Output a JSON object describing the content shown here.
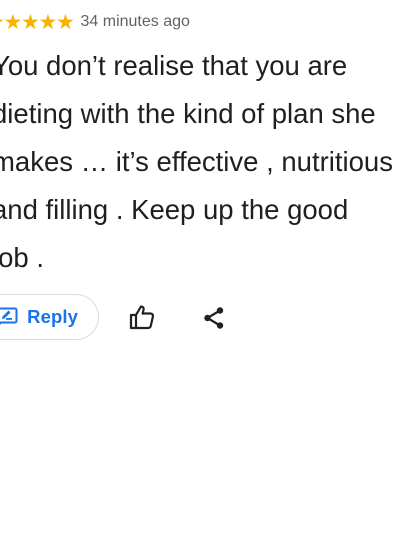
{
  "review": {
    "rating": 5,
    "stars": [
      "★",
      "★",
      "★",
      "★",
      "★"
    ],
    "timestamp": "34 minutes ago",
    "text_lines": [
      "You don’t realise that you are",
      "dieting with the kind of plan she",
      "makes … it’s effective , nutritious",
      "and filling . Keep up the good",
      "job ."
    ]
  },
  "actions": {
    "reply_label": "Reply",
    "reply_icon": "reply-icon",
    "like_icon": "thumbs-up-icon",
    "share_icon": "share-icon"
  },
  "colors": {
    "star": "#f4b400",
    "accent": "#1a73e8",
    "text": "#1f1f1f",
    "muted": "#5f6368",
    "border": "#dadce0"
  }
}
